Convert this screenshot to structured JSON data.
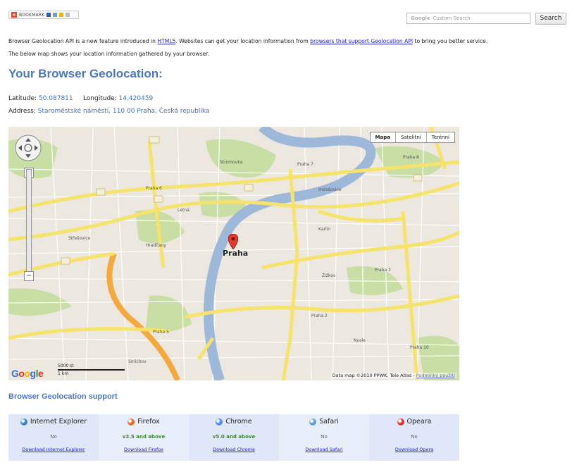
{
  "bookmark": {
    "label": "BOOKMARK"
  },
  "search": {
    "placeholder": "Custom Search",
    "google_label": "Google",
    "button": "Search"
  },
  "intro": {
    "part1": "Browser Geolocation API is a new feature introduced in ",
    "link1": "HTML5",
    "part2": ". Websites can get your location information from ",
    "link2": "browsers that support Geolocation API",
    "part3": " to bring you better service.",
    "line2": "The below map shows your location information gathered by your browser."
  },
  "page_title": "Your Browser Geolocation:",
  "location": {
    "lat_label": "Latitude:",
    "lat": "50.087811",
    "lon_label": "Longitude:",
    "lon": "14.420459",
    "addr_label": "Address:",
    "addr": "Staroměstské náměstí, 110 00 Praha, Česká republika"
  },
  "map": {
    "types": [
      "Mapa",
      "Satelitní",
      "Terénní"
    ],
    "center_label": "Praha",
    "google_logo": "Google",
    "scale_top": "5000 st",
    "scale_bottom": "1 km",
    "attribution": "Data map ©2010 PPWK, Tele Atlas - ",
    "terms": "Podmínky použití",
    "place_labels": [
      "Praha 6",
      "Praha 7",
      "Praha 8",
      "Praha 5",
      "Praha 2",
      "Praha 3",
      "Praha 10",
      "Holešovice",
      "Karlín",
      "Žižkov",
      "Střešovice",
      "Hradčany",
      "Smíchov",
      "Stromovka",
      "Letná",
      "Nusle"
    ],
    "colors": {
      "road": "#f6e36b",
      "highway": "#f5a93c",
      "river": "#9db8d9",
      "park": "#c8dea4"
    }
  },
  "support": {
    "title": "Browser Geolocation support",
    "browsers": [
      {
        "name": "Internet Explorer",
        "version": "No",
        "ok": false,
        "download": "Download Internet Explorer",
        "icon": "ie-icon",
        "color": "#3b84c9"
      },
      {
        "name": "Firefox",
        "version": "v3.5 and above",
        "ok": true,
        "download": "Download Firefox",
        "icon": "firefox-icon",
        "color": "#e4692b"
      },
      {
        "name": "Chrome",
        "version": "v5.0 and above",
        "ok": true,
        "download": "Download Chrome",
        "icon": "chrome-icon",
        "color": "#4c8bf5"
      },
      {
        "name": "Safari",
        "version": "No",
        "ok": false,
        "download": "Download Safari",
        "icon": "safari-icon",
        "color": "#5d9fd8"
      },
      {
        "name": "Opeara",
        "version": "No",
        "ok": false,
        "download": "Download Opera",
        "icon": "opera-icon",
        "color": "#d33"
      }
    ]
  }
}
